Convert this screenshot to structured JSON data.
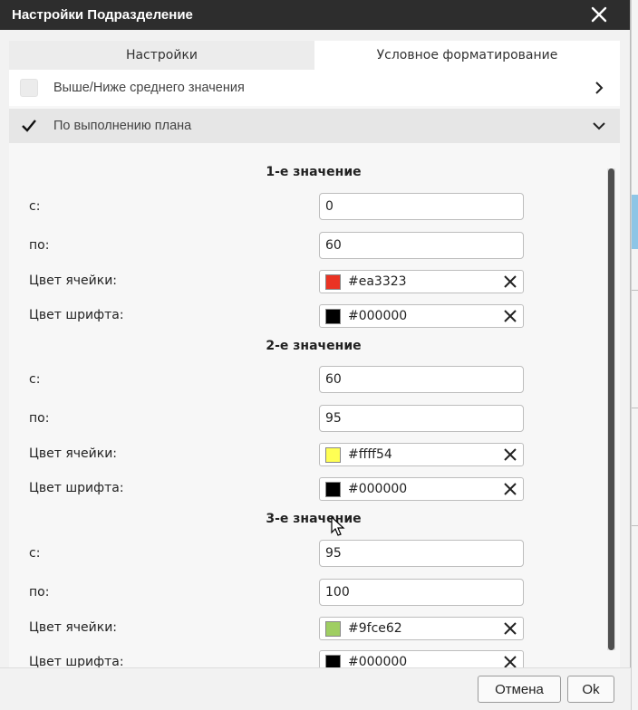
{
  "dialog": {
    "title": "Настройки Подразделение",
    "close_icon": "close-icon"
  },
  "tabs": [
    {
      "label": "Настройки",
      "active": false
    },
    {
      "label": "Условное форматирование",
      "active": true
    }
  ],
  "accordion": [
    {
      "label": "Выше/Ниже среднего значения",
      "checked": false,
      "expanded": false
    },
    {
      "label": "По выполнению плана",
      "checked": true,
      "expanded": true
    }
  ],
  "form": {
    "labels": {
      "from": "с:",
      "to": "по:",
      "cell_color": "Цвет ячейки:",
      "font_color": "Цвет шрифта:"
    },
    "sections": [
      {
        "title": "1-е значение",
        "from": "0",
        "to": "60",
        "cell_color": "#ea3323",
        "font_color": "#000000"
      },
      {
        "title": "2-е значение",
        "from": "60",
        "to": "95",
        "cell_color": "#ffff54",
        "font_color": "#000000"
      },
      {
        "title": "3-е значение",
        "from": "95",
        "to": "100",
        "cell_color": "#9fce62",
        "font_color": "#000000"
      }
    ]
  },
  "footer": {
    "cancel_label": "Отмена",
    "ok_label": "Ok"
  }
}
